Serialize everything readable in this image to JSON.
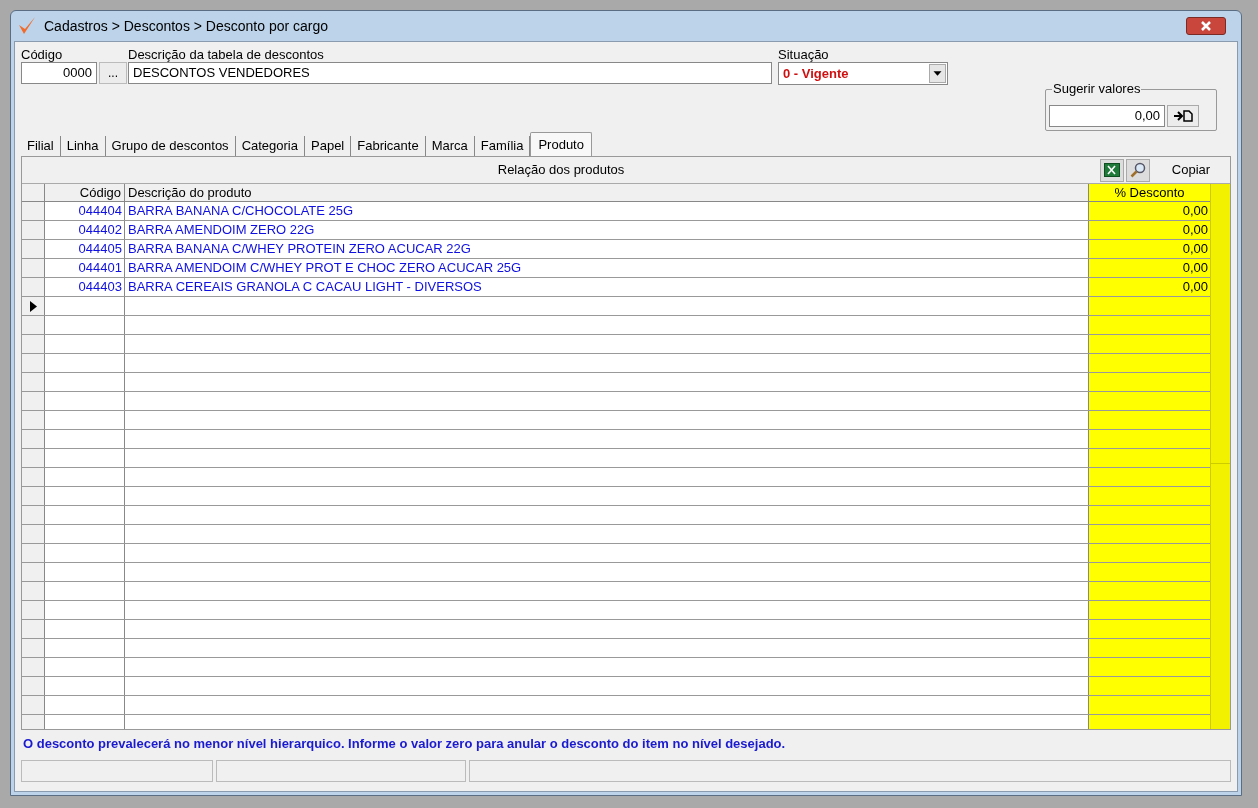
{
  "window": {
    "title": "Cadastros > Descontos > Desconto por cargo"
  },
  "form": {
    "code_label": "Código",
    "code_value": "0000",
    "lookup_button": "...",
    "description_label": "Descrição da tabela de descontos",
    "description_value": "DESCONTOS VENDEDORES",
    "status_label": "Situação",
    "status_value": "0 - Vigente"
  },
  "suggest": {
    "label": "Sugerir valores",
    "value": "0,00"
  },
  "tabs": [
    {
      "label": "Filial",
      "selected": false
    },
    {
      "label": "Linha",
      "selected": false
    },
    {
      "label": "Grupo de descontos",
      "selected": false
    },
    {
      "label": "Categoria",
      "selected": false
    },
    {
      "label": "Papel",
      "selected": false
    },
    {
      "label": "Fabricante",
      "selected": false
    },
    {
      "label": "Marca",
      "selected": false
    },
    {
      "label": "Família",
      "selected": false
    },
    {
      "label": "Produto",
      "selected": true
    }
  ],
  "grid": {
    "title": "Relação dos produtos",
    "copy_button": "Copiar",
    "columns": [
      "Código",
      "Descrição do produto",
      "% Desconto"
    ],
    "rows": [
      {
        "code": "044404",
        "description": "BARRA BANANA C/CHOCOLATE 25G",
        "discount": "0,00",
        "current": false
      },
      {
        "code": "044402",
        "description": "BARRA AMENDOIM ZERO 22G",
        "discount": "0,00",
        "current": false
      },
      {
        "code": "044405",
        "description": "BARRA BANANA C/WHEY PROTEIN ZERO ACUCAR 22G",
        "discount": "0,00",
        "current": false
      },
      {
        "code": "044401",
        "description": "BARRA AMENDOIM C/WHEY PROT E CHOC ZERO ACUCAR 25G",
        "discount": "0,00",
        "current": false
      },
      {
        "code": "044403",
        "description": "BARRA CEREAIS GRANOLA C CACAU LIGHT - DIVERSOS",
        "discount": "0,00",
        "current": false
      },
      {
        "code": "",
        "description": "",
        "discount": "",
        "current": true
      }
    ]
  },
  "hint": "O desconto prevalecerá no menor nível hierarquico. Informe o valor zero para anular o desconto do item no nível desejado."
}
